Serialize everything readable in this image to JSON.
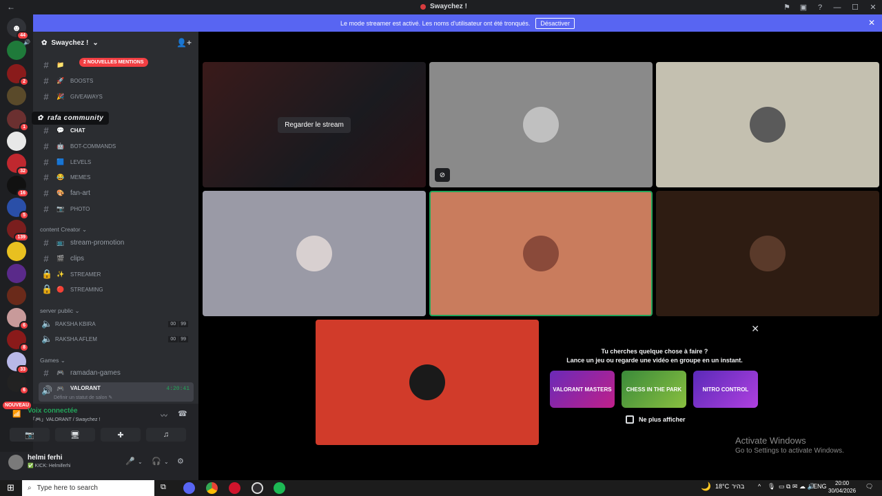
{
  "window": {
    "title": "Swaychez !",
    "back": "←",
    "forward": "→"
  },
  "banner": {
    "text": "Le mode streamer est activé. Les noms d'utilisateur ont été tronqués.",
    "button": "Désactiver",
    "close": "✕"
  },
  "servers": {
    "badges": [
      "44",
      "2",
      "1",
      "32",
      "16",
      "5",
      "139",
      "6",
      "8",
      "33",
      "6"
    ],
    "nouveau": "NOUVEAU"
  },
  "guild": {
    "name": "Swaychez !",
    "chevron": "⌄"
  },
  "tooltip": {
    "text": "rafa community"
  },
  "mentions_pill": "2 NOUVELLES MENTIONS",
  "channels": [
    {
      "emoji": "📁",
      "name": ""
    },
    {
      "emoji": "🚀",
      "name": "BOOSTS"
    },
    {
      "emoji": "🎉",
      "name": "GIVEAWAYS"
    },
    {
      "emoji": "💬",
      "name": "CHAT"
    },
    {
      "emoji": "🤖",
      "name": "BOT-COMMANDS"
    },
    {
      "emoji": "🟦",
      "name": "LEVELS"
    },
    {
      "emoji": "😂",
      "name": "MEMES"
    },
    {
      "emoji": "🎨",
      "name": "fan-art"
    },
    {
      "emoji": "📷",
      "name": "PHOTO"
    }
  ],
  "category_content": "content Creator",
  "content_channels": [
    {
      "emoji": "📺",
      "name": "stream-promotion"
    },
    {
      "emoji": "🎬",
      "name": "clips"
    },
    {
      "emoji": "✨",
      "name": "STREAMER"
    },
    {
      "emoji": "🔴",
      "name": "STREAMING"
    }
  ],
  "category_public": "server public",
  "voice_channels": [
    {
      "name": "RAKSHA KBIRA",
      "c1": "00",
      "c2": "99"
    },
    {
      "name": "RAKSHA AFLEM",
      "c1": "00",
      "c2": "99"
    }
  ],
  "category_games": "Games",
  "game_channels": [
    {
      "name": "ramadan-games"
    },
    {
      "name": "VALORANT",
      "time": "4:20:41",
      "status": "Définir un statut de salon ✎"
    }
  ],
  "voice_panel": {
    "status": "Voix connectée",
    "sub": "「🎮」VALORANT / Swaychez !"
  },
  "user": {
    "name": "helmi ferhi",
    "status": "✅ KICK: Helmiferhi"
  },
  "stream": {
    "watch_label": "Regarder le stream"
  },
  "activity": {
    "title1": "Tu cherches quelque chose à faire ?",
    "title2": "Lance un jeu ou regarde une vidéo en groupe en un instant.",
    "games": [
      "VALORANT MASTERS",
      "CHESS IN THE PARK",
      "NITRO CONTROL"
    ],
    "no_show": "Ne plus afficher",
    "close": "✕"
  },
  "watermark": {
    "line1": "Activate Windows",
    "line2": "Go to Settings to activate Windows."
  },
  "taskbar": {
    "search": "Type here to search",
    "weather": "18°C",
    "weather_text": "בהיר",
    "lang": "ENG",
    "time": "20:00",
    "date": "30/04/2026"
  }
}
